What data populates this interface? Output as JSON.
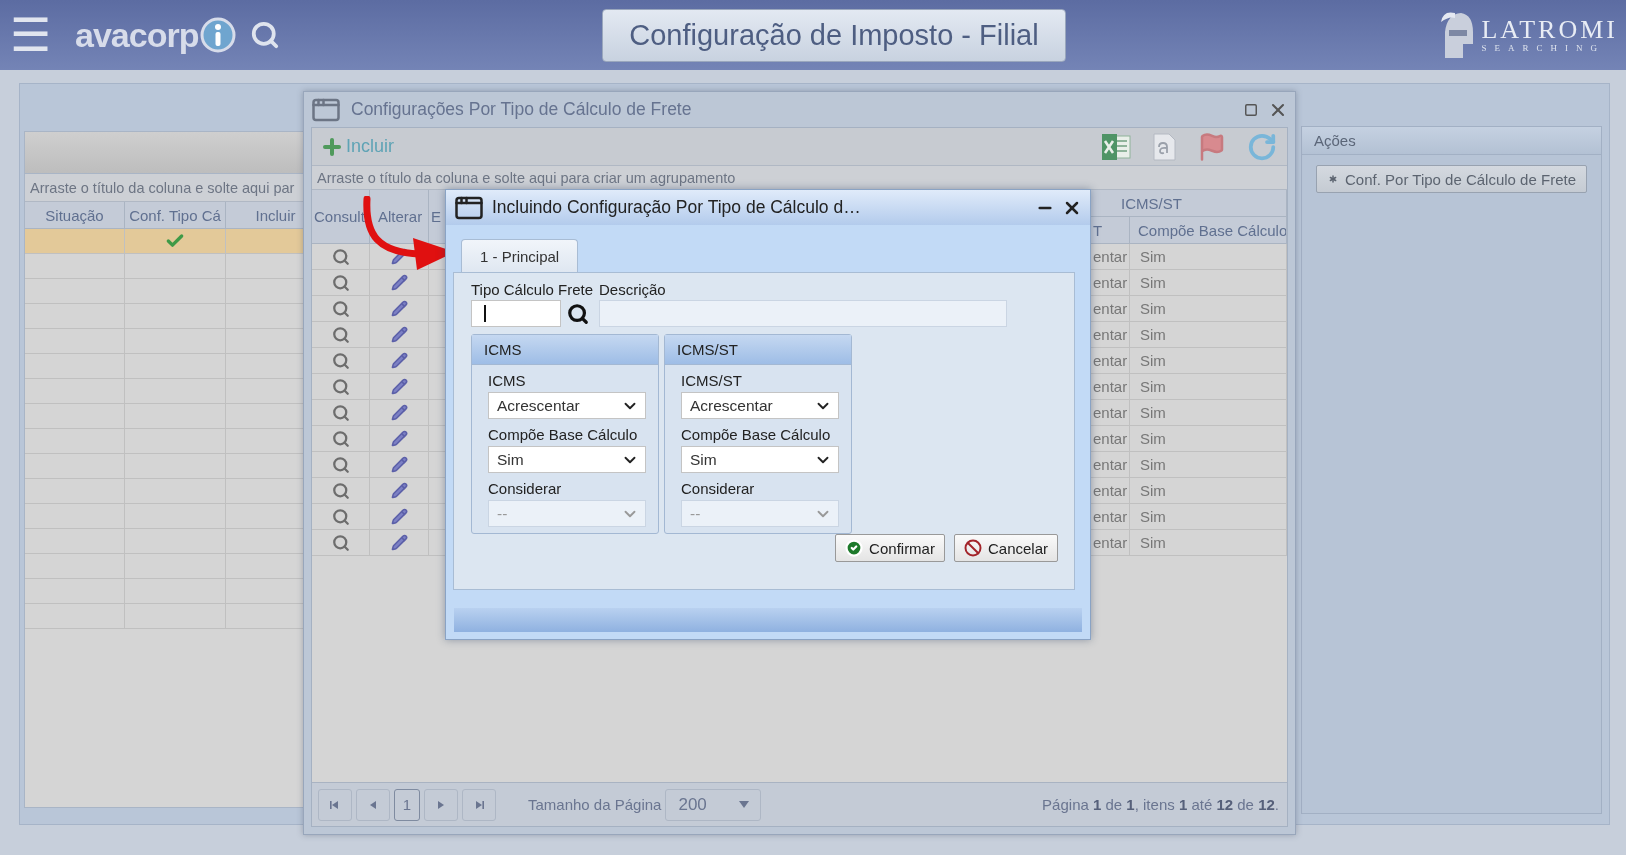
{
  "header": {
    "menu": "☰",
    "logo_text": "avacorp",
    "title": "Configuração de Imposto - Filial",
    "brand": "LATROMI",
    "brand_tagline": "SEARCHING"
  },
  "main_grid": {
    "group_hint": "Arraste o título da coluna e solte aqui par",
    "columns": [
      "Situação",
      "Conf. Tipo Cá",
      "Incluir"
    ],
    "rows": [
      {
        "selected": true,
        "configured": true
      },
      {
        "selected": false,
        "configured": false
      },
      {
        "selected": false,
        "configured": false
      },
      {
        "selected": false,
        "configured": false
      },
      {
        "selected": false,
        "configured": false
      },
      {
        "selected": false,
        "configured": false
      },
      {
        "selected": false,
        "configured": false
      },
      {
        "selected": false,
        "configured": false
      },
      {
        "selected": false,
        "configured": false
      },
      {
        "selected": false,
        "configured": false
      },
      {
        "selected": false,
        "configured": false
      },
      {
        "selected": false,
        "configured": false
      },
      {
        "selected": false,
        "configured": false
      },
      {
        "selected": false,
        "configured": false
      },
      {
        "selected": false,
        "configured": false
      },
      {
        "selected": false,
        "configured": false
      }
    ]
  },
  "actions_panel": {
    "title": "Ações",
    "buttons": [
      "Conf. Por Tipo de Cálculo de Frete"
    ]
  },
  "window": {
    "title": "Configurações Por Tipo de Cálculo de Frete",
    "add_label": "Incluir",
    "group_hint": "Arraste o título da coluna e solte aqui para criar um agrupamento",
    "columns": [
      "Consult",
      "Alterar",
      "E"
    ],
    "group_header": "ICMS/ST",
    "sub_columns": [
      "T",
      "Compõe Base Cálculo"
    ],
    "rows": [
      {
        "cells": [
          "entar",
          "Sim"
        ]
      },
      {
        "cells": [
          "entar",
          "Sim"
        ]
      },
      {
        "cells": [
          "entar",
          "Sim"
        ]
      },
      {
        "cells": [
          "entar",
          "Sim"
        ]
      },
      {
        "cells": [
          "entar",
          "Sim"
        ]
      },
      {
        "cells": [
          "entar",
          "Sim"
        ]
      },
      {
        "cells": [
          "entar",
          "Sim"
        ]
      },
      {
        "cells": [
          "entar",
          "Sim"
        ]
      },
      {
        "cells": [
          "entar",
          "Sim"
        ]
      },
      {
        "cells": [
          "entar",
          "Sim"
        ]
      },
      {
        "cells": [
          "entar",
          "Sim"
        ]
      },
      {
        "cells": [
          "entar",
          "Sim"
        ]
      }
    ],
    "pager": {
      "page": "1",
      "page_size_label": "Tamanho da Página",
      "page_size": "200",
      "summary": "Página **1** de **1**, itens **1** até **12** de **12**."
    }
  },
  "dialog": {
    "title": "Incluindo Configuração Por Tipo de Cálculo d…",
    "tabs": [
      {
        "label": "1 - Principal",
        "selected": true
      }
    ],
    "tipo_label": "Tipo Cálculo Frete",
    "tipo_focused": true,
    "descricao_label": "Descrição",
    "groups": [
      {
        "title": "ICMS",
        "fields": [
          {
            "label": "ICMS",
            "value": "Acrescentar",
            "disabled": false
          },
          {
            "label": "Compõe Base Cálculo",
            "value": "Sim",
            "disabled": false
          },
          {
            "label": "Considerar",
            "value": "--",
            "disabled": true
          }
        ]
      },
      {
        "title": "ICMS/ST",
        "fields": [
          {
            "label": "ICMS/ST",
            "value": "Acrescentar",
            "disabled": false
          },
          {
            "label": "Compõe Base Cálculo",
            "value": "Sim",
            "disabled": false
          },
          {
            "label": "Considerar",
            "value": "--",
            "disabled": true
          }
        ]
      }
    ],
    "buttons": [
      {
        "kind": "confirm",
        "label": "Confirmar"
      },
      {
        "kind": "cancel",
        "label": "Cancelar"
      }
    ]
  }
}
